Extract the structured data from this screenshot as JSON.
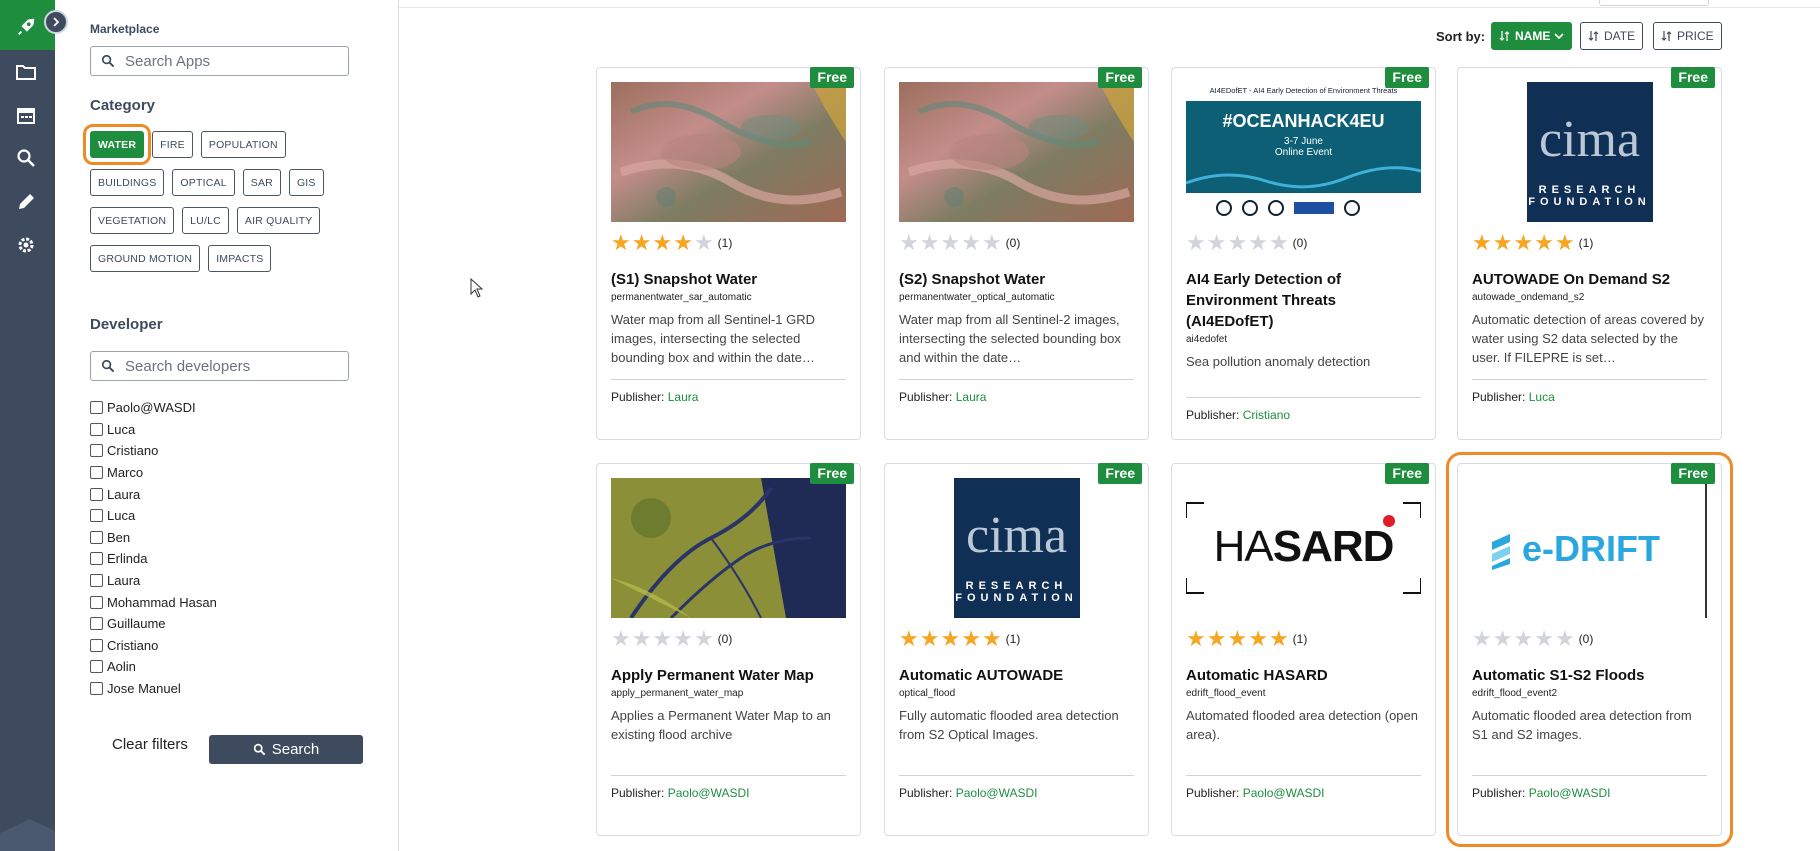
{
  "nav": {
    "items": [
      "rocket-icon",
      "folder-icon",
      "calendar-icon",
      "search-icon",
      "pencil-icon",
      "gear-icon"
    ]
  },
  "filters": {
    "marketplace_label": "Marketplace",
    "search_apps_placeholder": "Search Apps",
    "category_heading": "Category",
    "categories": [
      [
        "WATER",
        "FIRE",
        "POPULATION"
      ],
      [
        "BUILDINGS",
        "OPTICAL",
        "SAR",
        "GIS"
      ],
      [
        "VEGETATION",
        "LU/LC",
        "AIR QUALITY"
      ],
      [
        "GROUND MOTION",
        "IMPACTS"
      ]
    ],
    "selected_category": "WATER",
    "developer_heading": "Developer",
    "search_developers_placeholder": "Search developers",
    "developers": [
      "Paolo@WASDI",
      "Luca",
      "Cristiano",
      "Marco",
      "Laura",
      "Luca",
      "Ben",
      "Erlinda",
      "Laura",
      "Mohammad Hasan",
      "Guillaume",
      "Cristiano",
      "Aolin",
      "Jose Manuel"
    ],
    "clear_label": "Clear filters",
    "search_label": "Search"
  },
  "sort": {
    "label": "Sort by:",
    "options": [
      "NAME",
      "DATE",
      "PRICE"
    ],
    "active": "NAME"
  },
  "publisher_label": "Publisher:",
  "colors": {
    "accent_green": "#1e8e3e",
    "nav_bg": "#3e4b5e",
    "highlight_orange": "#f08a24",
    "star_gold": "#f5a623"
  },
  "apps": [
    {
      "badge": "Free",
      "rating": 4,
      "count": "(1)",
      "title": "(S1) Snapshot Water",
      "id": "permanentwater_sar_automatic",
      "desc": "Water map from all Sentinel-1 GRD images, intersecting the selected bounding box and within the date…",
      "publisher": "Laura",
      "thumb": "satellite"
    },
    {
      "badge": "Free",
      "rating": 0,
      "count": "(0)",
      "title": "(S2) Snapshot Water",
      "id": "permanentwater_optical_automatic",
      "desc": "Water map from all Sentinel-2 images, intersecting the selected bounding box and within the date…",
      "publisher": "Laura",
      "thumb": "satellite"
    },
    {
      "badge": "Free",
      "rating": 0,
      "count": "(0)",
      "title": "AI4 Early Detection of Environment Threats (AI4EDofET)",
      "id": "ai4edofet",
      "desc": "Sea pollution anomaly detection",
      "publisher": "Cristiano",
      "thumb": "oceanhack",
      "thumb_text": {
        "top": "AI4EDofET - AI4 Early Detection of Environment Threats",
        "hashtag": "#OCEANHACK4EU",
        "dates": "3-7 June",
        "event": "Online Event"
      }
    },
    {
      "badge": "Free",
      "rating": 5,
      "count": "(1)",
      "title": "AUTOWADE On Demand S2",
      "id": "autowade_ondemand_s2",
      "desc": "Automatic detection of areas covered by water using S2 data selected by the user. If FILEPRE is set…",
      "publisher": "Luca",
      "thumb": "cima",
      "thumb_text": {
        "logo": "cima",
        "line1": "RESEARCH",
        "line2": "FOUNDATION"
      }
    },
    {
      "badge": "Free",
      "rating": 0,
      "count": "(0)",
      "title": "Apply Permanent Water Map",
      "id": "apply_permanent_water_map",
      "desc": "Applies a Permanent Water Map to an existing flood archive",
      "publisher": "Paolo@WASDI",
      "thumb": "delta"
    },
    {
      "badge": "Free",
      "rating": 5,
      "count": "(1)",
      "title": "Automatic AUTOWADE",
      "id": "optical_flood",
      "desc": "Fully automatic flooded area detection from S2 Optical Images.",
      "publisher": "Paolo@WASDI",
      "thumb": "cima",
      "thumb_text": {
        "logo": "cima",
        "line1": "RESEARCH",
        "line2": "FOUNDATION"
      }
    },
    {
      "badge": "Free",
      "rating": 5,
      "count": "(1)",
      "title": "Automatic HASARD",
      "id": "edrift_flood_event",
      "desc": "Automated flooded area detection (open area).",
      "publisher": "Paolo@WASDI",
      "thumb": "hasard",
      "thumb_text": {
        "logo_a": "HA",
        "logo_b": "SARD"
      }
    },
    {
      "badge": "Free",
      "rating": 0,
      "count": "(0)",
      "title": "Automatic S1-S2 Floods",
      "id": "edrift_flood_event2",
      "desc": "Automatic flooded area detection from S1 and S2 images.",
      "publisher": "Paolo@WASDI",
      "thumb": "edrift",
      "highlighted": true,
      "thumb_text": {
        "logo": "e-DRIFT"
      }
    }
  ]
}
